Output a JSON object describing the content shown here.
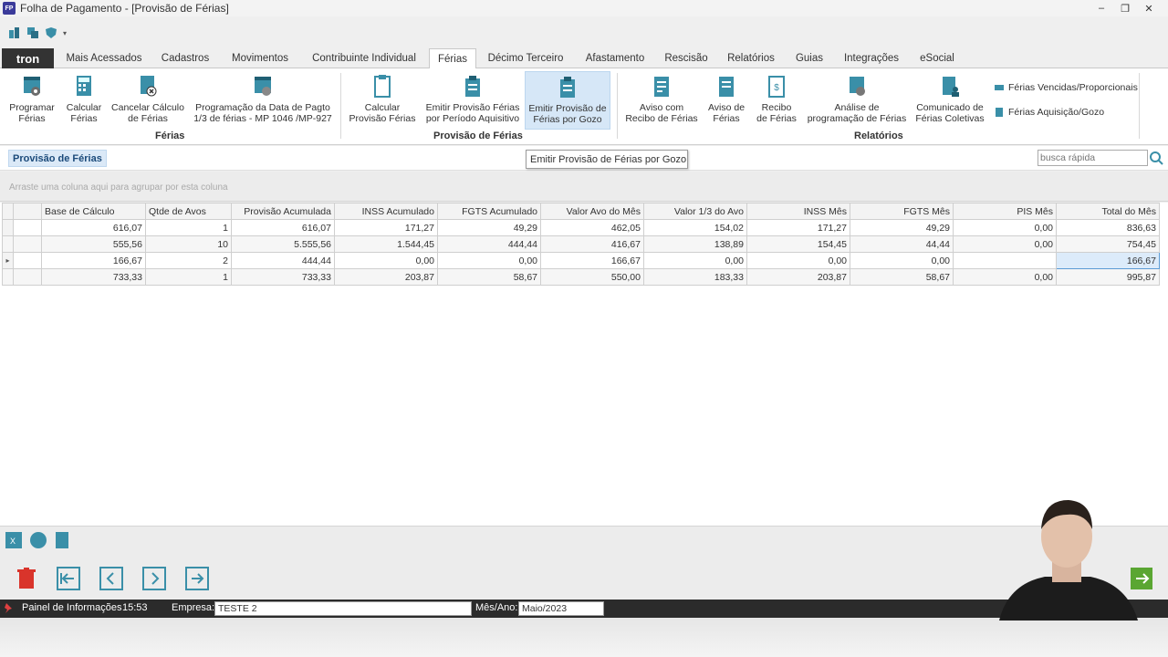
{
  "window": {
    "title": "Folha de Pagamento - [Provisão de Férias]",
    "app_badge": "FP"
  },
  "tabs": [
    {
      "label": "Mais Acessados"
    },
    {
      "label": "Cadastros"
    },
    {
      "label": "Movimentos"
    },
    {
      "label": "Contribuinte Individual"
    },
    {
      "label": "Férias",
      "active": true
    },
    {
      "label": "Décimo Terceiro"
    },
    {
      "label": "Afastamento"
    },
    {
      "label": "Rescisão"
    },
    {
      "label": "Relatórios"
    },
    {
      "label": "Guias"
    },
    {
      "label": "Integrações"
    },
    {
      "label": "eSocial"
    }
  ],
  "logo": "tron",
  "ribbon": {
    "ferias_group": {
      "label": "Férias",
      "buttons": [
        {
          "line1": "Programar",
          "line2": "Férias"
        },
        {
          "line1": "Calcular",
          "line2": "Férias"
        },
        {
          "line1": "Cancelar Cálculo",
          "line2": "de Férias"
        },
        {
          "line1": "Programação da Data de Pagto",
          "line2": "1/3 de férias - MP 1046 /MP-927"
        }
      ]
    },
    "provisao_group": {
      "label": "Provisão de Férias",
      "buttons": [
        {
          "line1": "Calcular",
          "line2": "Provisão Férias"
        },
        {
          "line1": "Emitir Provisão Férias",
          "line2": "por Período Aquisitivo"
        },
        {
          "line1": "Emitir Provisão de",
          "line2": "Férias por Gozo"
        }
      ]
    },
    "relatorios_group": {
      "label": "Relatórios",
      "buttons": [
        {
          "line1": "Aviso com",
          "line2": "Recibo de Férias"
        },
        {
          "line1": "Aviso de",
          "line2": "Férias"
        },
        {
          "line1": "Recibo",
          "line2": "de Férias"
        },
        {
          "line1": "Análise de",
          "line2": "programação de Férias"
        },
        {
          "line1": "Comunicado de",
          "line2": "Férias Coletivas"
        }
      ],
      "side": [
        {
          "label": "Férias Vencidas/Proporcionais"
        },
        {
          "label": "Férias Aquisição/Gozo"
        }
      ]
    }
  },
  "page_tab": "Provisão de Férias",
  "tooltip": "Emitir Provisão de Férias por Gozo",
  "search": {
    "placeholder": "busca rápida"
  },
  "group_hint": "Arraste uma coluna aqui para agrupar por esta coluna",
  "grid": {
    "columns": [
      "Base de Cálculo",
      "Qtde de Avos",
      "Provisão Acumulada",
      "INSS Acumulado",
      "FGTS Acumulado",
      "Valor Avo do Mês",
      "Valor 1/3 do Avo",
      "INSS Mês",
      "FGTS Mês",
      "PIS Mês",
      "Total do Mês"
    ],
    "rows": [
      [
        "616,07",
        "1",
        "616,07",
        "171,27",
        "49,29",
        "462,05",
        "154,02",
        "171,27",
        "49,29",
        "0,00",
        "836,63"
      ],
      [
        "555,56",
        "10",
        "5.555,56",
        "1.544,45",
        "444,44",
        "416,67",
        "138,89",
        "154,45",
        "44,44",
        "0,00",
        "754,45"
      ],
      [
        "166,67",
        "2",
        "444,44",
        "0,00",
        "0,00",
        "166,67",
        "0,00",
        "0,00",
        "0,00",
        "",
        "166,67"
      ],
      [
        "733,33",
        "1",
        "733,33",
        "203,87",
        "58,67",
        "550,00",
        "183,33",
        "203,87",
        "58,67",
        "0,00",
        "995,87"
      ]
    ],
    "current_row": 2
  },
  "status": {
    "panel": "Painel de Informações",
    "time": "15:53",
    "empresa_label": "Empresa:",
    "empresa_value": "TESTE 2",
    "mes_label": "Mês/Ano:",
    "mes_value": "Maio/2023"
  },
  "colors": {
    "accent_teal": "#3a8fa8",
    "status_bg": "#2b2b2b",
    "selection": "#dcebfa",
    "delete_red": "#d9342b",
    "exit_green": "#5aa632"
  }
}
